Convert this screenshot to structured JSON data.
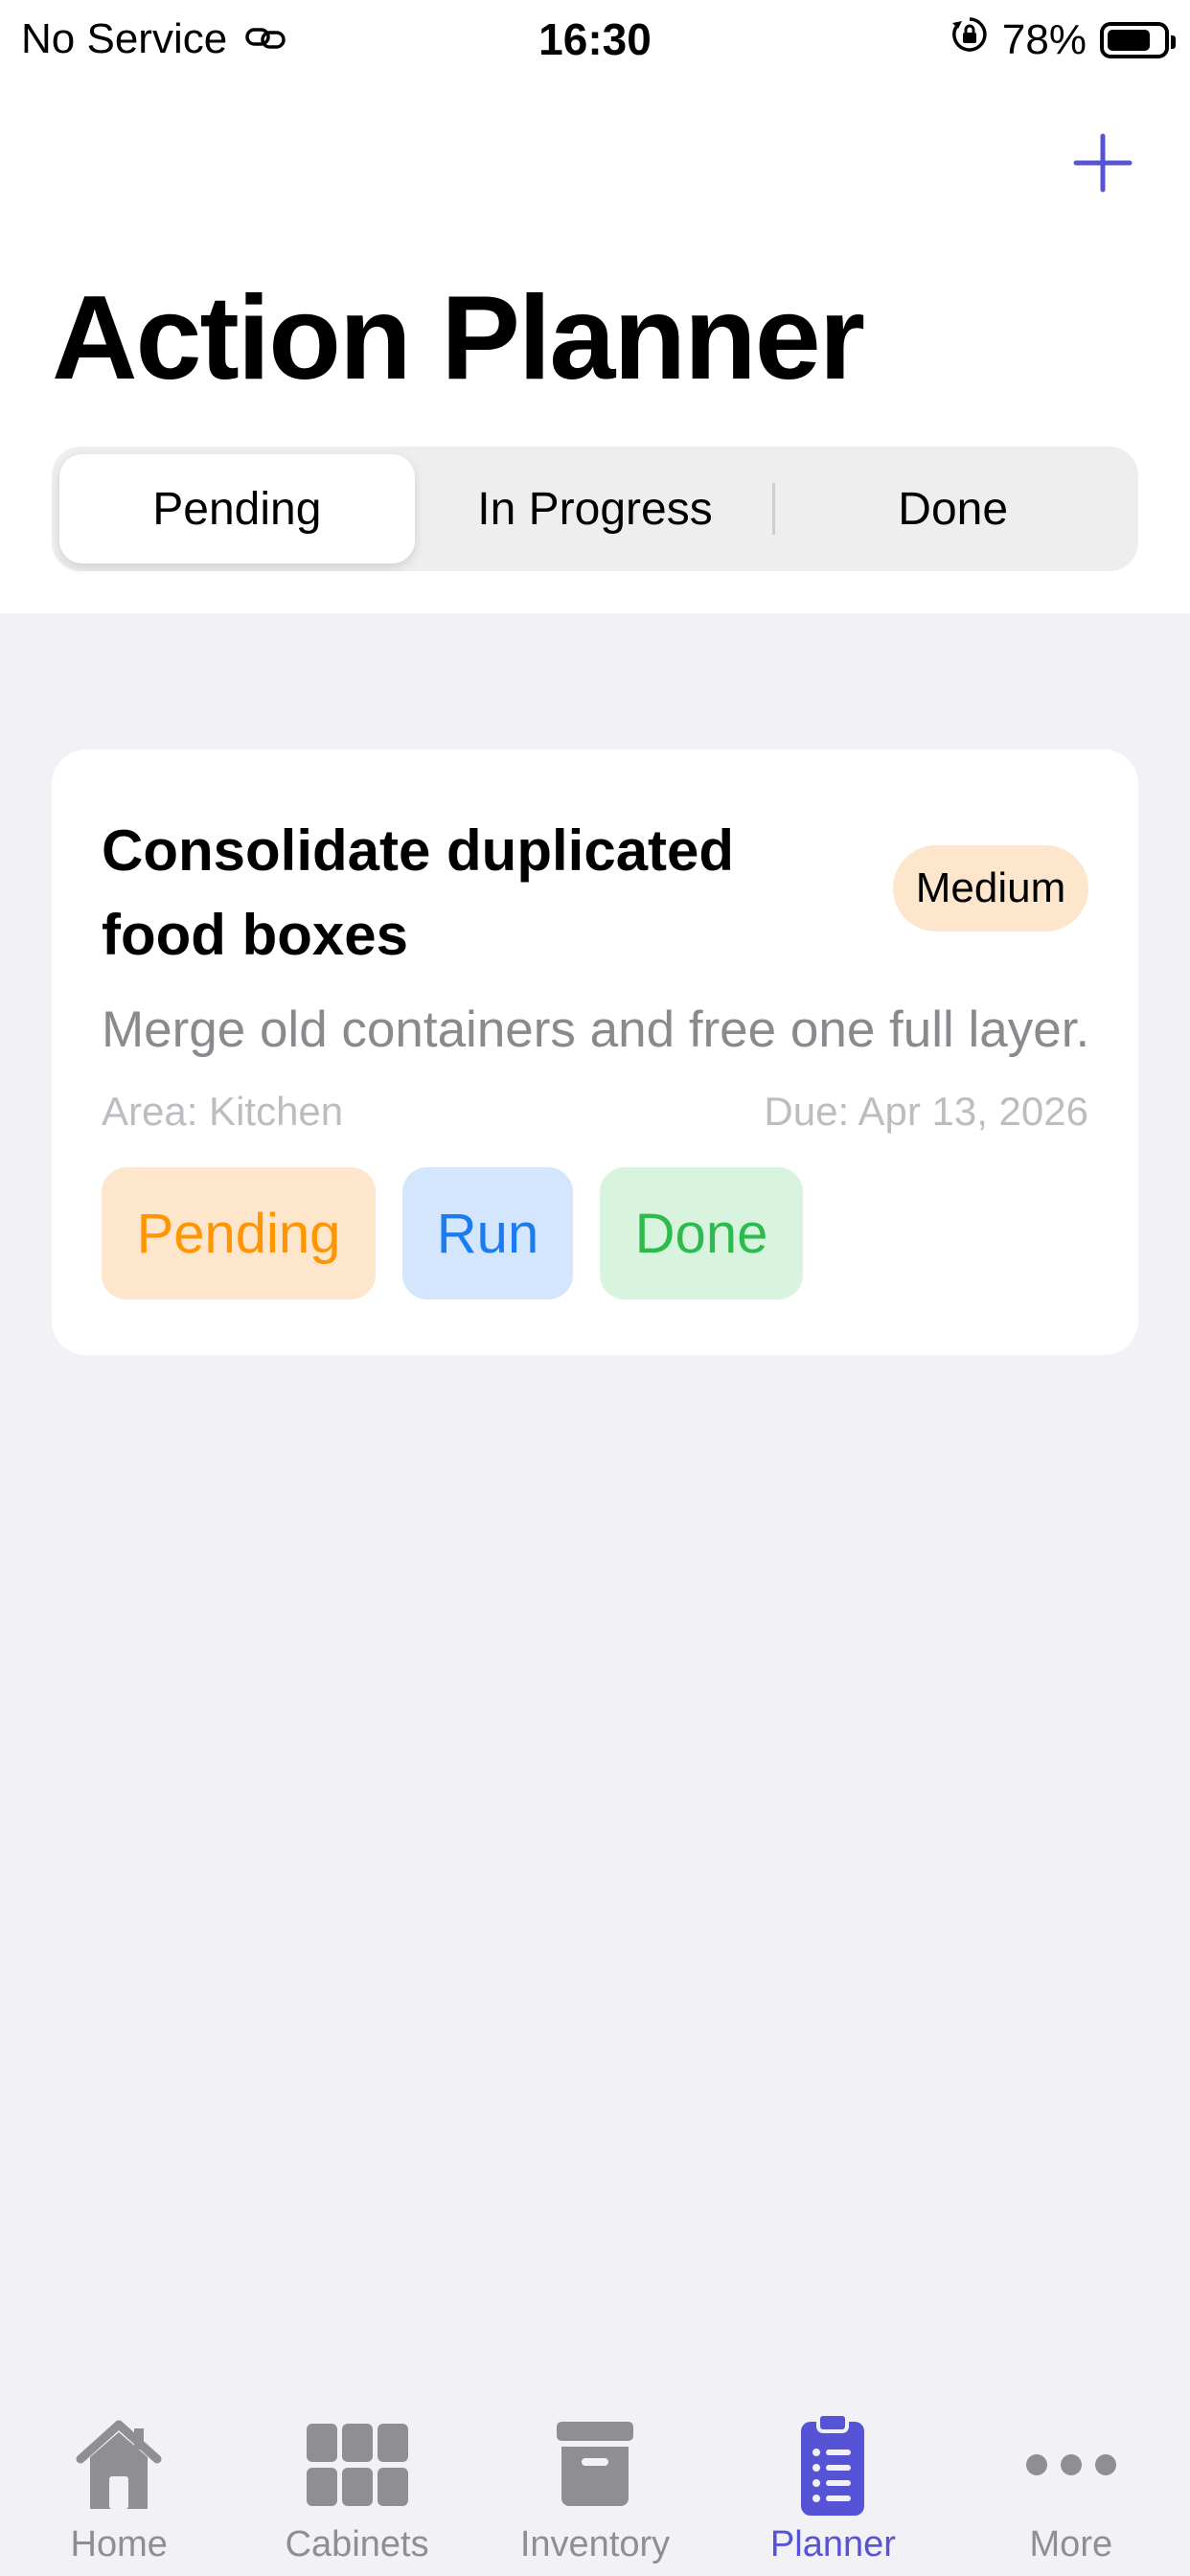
{
  "status_bar": {
    "carrier": "No Service",
    "time": "16:30",
    "battery": "78%",
    "battery_level": 0.78
  },
  "header": {
    "title": "Action Planner",
    "add_icon": "plus-icon"
  },
  "segments": [
    {
      "label": "Pending",
      "active": true
    },
    {
      "label": "In Progress",
      "active": false
    },
    {
      "label": "Done",
      "active": false
    }
  ],
  "tasks": [
    {
      "title": "Consolidate duplicated food boxes",
      "priority": "Medium",
      "description": "Merge old containers and free one full layer.",
      "area": "Area: Kitchen",
      "due": "Due: Apr 13, 2026",
      "actions": {
        "pending": "Pending",
        "run": "Run",
        "done": "Done"
      }
    }
  ],
  "tab_bar": {
    "items": [
      {
        "label": "Home",
        "icon": "home-icon",
        "active": false
      },
      {
        "label": "Cabinets",
        "icon": "grid-icon",
        "active": false
      },
      {
        "label": "Inventory",
        "icon": "archive-box-icon",
        "active": false
      },
      {
        "label": "Planner",
        "icon": "clipboard-list-icon",
        "active": true
      },
      {
        "label": "More",
        "icon": "ellipsis-icon",
        "active": false
      }
    ]
  },
  "colors": {
    "accent": "#5653d6",
    "pending": "#ff9500",
    "run": "#1a7cf0",
    "done": "#2dbb4e",
    "background": "#f1f1f6"
  }
}
